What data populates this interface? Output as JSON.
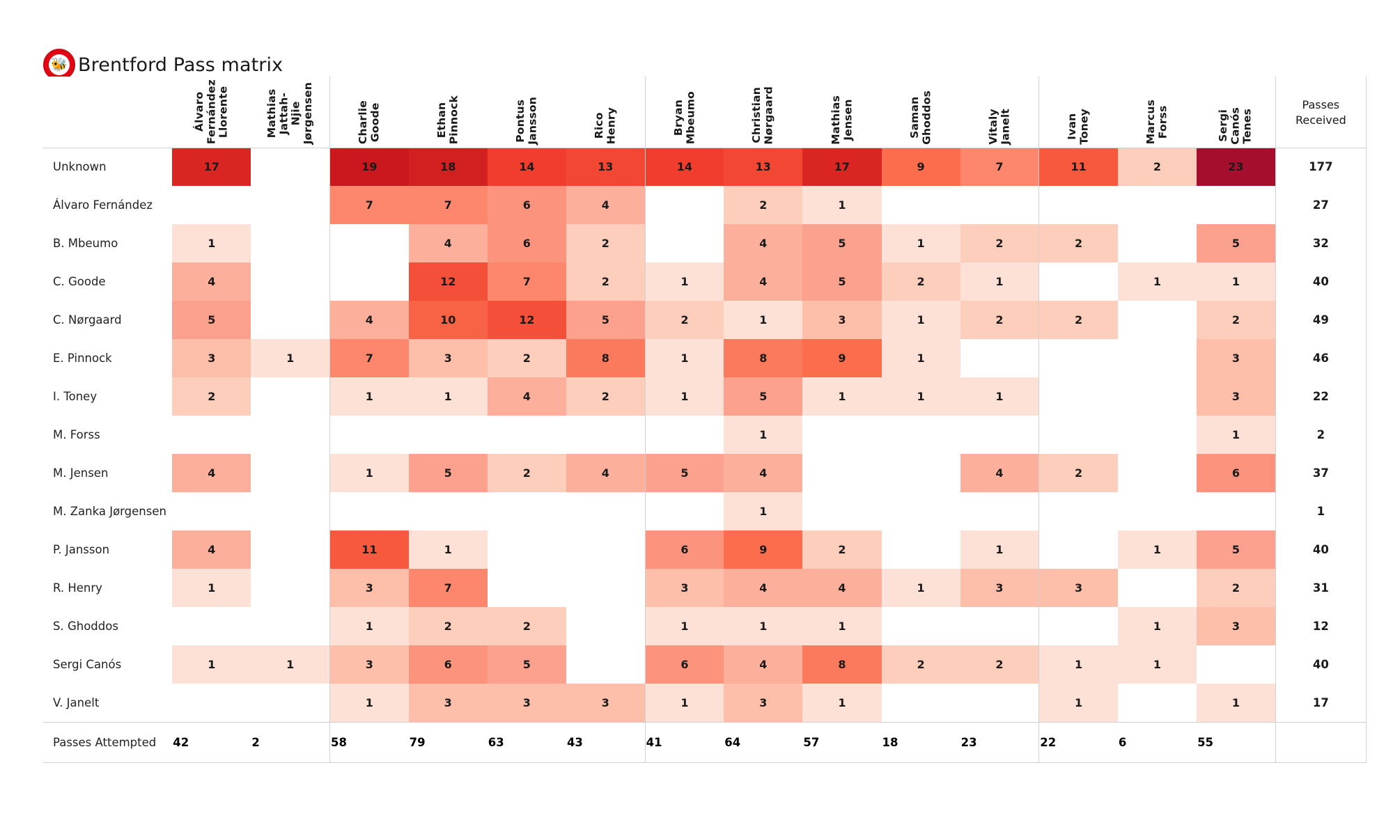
{
  "header": {
    "title": "Brentford Pass matrix",
    "crest_icon": "brentford-bee-crest-icon",
    "bee_glyph": "🐝"
  },
  "colors": {
    "scale_min": "#ffffff",
    "scale_low": "#fcbba1",
    "scale_mid": "#fb6a4a",
    "scale_high": "#cb181d",
    "scale_max": "#a50f2d",
    "empty": "#ffffff",
    "crest_red": "#e30613",
    "grid_line": "#cfcfcf"
  },
  "chart_data": {
    "type": "heatmap",
    "title": "Brentford Pass matrix",
    "xlabel": "",
    "ylabel": "",
    "grid": false,
    "legend": "none",
    "value_range": [
      0,
      23
    ],
    "columns": [
      "Álvaro\nFernández\nLlorente",
      "Mathias\nJattah-\nNjie\nJørgensen",
      "Charlie\nGoode",
      "Ethan\nPinnock",
      "Pontus\nJansson",
      "Rico\nHenry",
      "Bryan\nMbeumo",
      "Christian\nNørgaard",
      "Mathias\nJensen",
      "Saman\nGhoddos",
      "Vitaly\nJanelt",
      "Ivan\nToney",
      "Marcus\nForss",
      "Sergi\nCanós\nTenes"
    ],
    "column_group_breaks": [
      2,
      6,
      11
    ],
    "total_column_label": "Passes\nReceived",
    "footer_row_label": "Passes Attempted",
    "rows": [
      "Unknown",
      "Álvaro Fernández",
      "B. Mbeumo",
      "C. Goode",
      "C. Nørgaard",
      "E. Pinnock",
      "I. Toney",
      "M. Forss",
      "M. Jensen",
      "M. Zanka Jørgensen",
      "P. Jansson",
      "R. Henry",
      "S. Ghoddos",
      "Sergi Canós",
      "V. Janelt"
    ],
    "values": [
      [
        17,
        null,
        19,
        18,
        14,
        13,
        14,
        13,
        17,
        9,
        7,
        11,
        2,
        23
      ],
      [
        null,
        null,
        7,
        7,
        6,
        4,
        null,
        2,
        1,
        null,
        null,
        null,
        null,
        null
      ],
      [
        1,
        null,
        null,
        4,
        6,
        2,
        null,
        4,
        5,
        1,
        2,
        2,
        null,
        5
      ],
      [
        4,
        null,
        null,
        12,
        7,
        2,
        1,
        4,
        5,
        2,
        1,
        null,
        1,
        1
      ],
      [
        5,
        null,
        4,
        10,
        12,
        5,
        2,
        1,
        3,
        1,
        2,
        2,
        null,
        2
      ],
      [
        3,
        1,
        7,
        3,
        2,
        8,
        1,
        8,
        9,
        1,
        null,
        null,
        null,
        3
      ],
      [
        2,
        null,
        1,
        1,
        4,
        2,
        1,
        5,
        1,
        1,
        1,
        null,
        null,
        3
      ],
      [
        null,
        null,
        null,
        null,
        null,
        null,
        null,
        1,
        null,
        null,
        null,
        null,
        null,
        1
      ],
      [
        4,
        null,
        1,
        5,
        2,
        4,
        5,
        4,
        null,
        null,
        4,
        2,
        null,
        6
      ],
      [
        null,
        null,
        null,
        null,
        null,
        null,
        null,
        1,
        null,
        null,
        null,
        null,
        null,
        null
      ],
      [
        4,
        null,
        11,
        1,
        null,
        null,
        6,
        9,
        2,
        null,
        1,
        null,
        1,
        5
      ],
      [
        1,
        null,
        3,
        7,
        null,
        null,
        3,
        4,
        4,
        1,
        3,
        3,
        null,
        2
      ],
      [
        null,
        null,
        1,
        2,
        2,
        null,
        1,
        1,
        1,
        null,
        null,
        null,
        1,
        3
      ],
      [
        1,
        1,
        3,
        6,
        5,
        null,
        6,
        4,
        8,
        2,
        2,
        1,
        1,
        null
      ],
      [
        null,
        null,
        1,
        3,
        3,
        3,
        1,
        3,
        1,
        null,
        null,
        1,
        null,
        1
      ]
    ],
    "passes_received": [
      177,
      27,
      32,
      40,
      49,
      46,
      22,
      2,
      37,
      1,
      40,
      31,
      12,
      40,
      17
    ],
    "passes_attempted": [
      42,
      2,
      58,
      79,
      63,
      43,
      41,
      64,
      57,
      18,
      23,
      22,
      6,
      55
    ]
  }
}
